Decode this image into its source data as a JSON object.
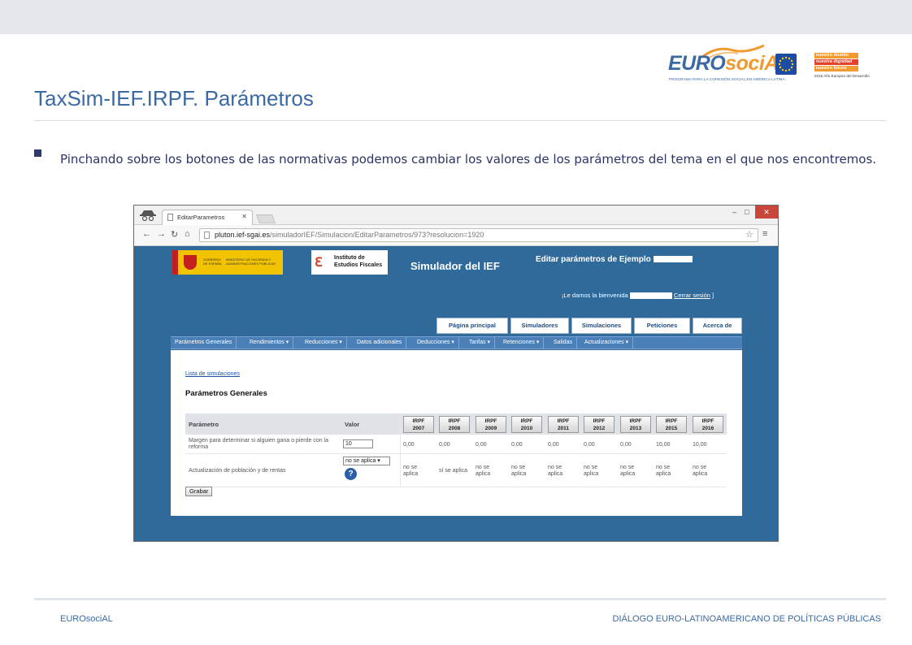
{
  "slide": {
    "title": "TaxSim-IEF.IRPF. Parámetros",
    "bullet": "Pinchando sobre los botones de las normativas podemos cambiar los valores de los parámetros del tema en el que nos encontremos."
  },
  "logos": {
    "eurosocial": {
      "euro": "EURO",
      "social": "sociAL",
      "tagline": "PROGRAMA PARA LA COHESIÓN SOCIAL EN AMÉRICA LATINA"
    },
    "nuestro_mundo": {
      "line1": "nuestro mundo",
      "line2": "nuestra dignidad",
      "line3": "nuestro futuro",
      "year": "2015 Año Europeo del Desarrollo"
    }
  },
  "browser": {
    "tab_title": "EditarParametros",
    "url_host": "pluton.ief-sgai.es",
    "url_path": "/simuladorIEF/Simulacion/EditarParametros/973?resolucion=1920",
    "window_close": "✕"
  },
  "webpage": {
    "gob_text1": "GOBIERNO DE ESPAÑA",
    "gob_text2": "MINISTERIO DE HACIENDA Y ADMINISTRACIONES PÚBLICAS",
    "ief_line1": "Instituto de",
    "ief_line2": "Estudios Fiscales",
    "app_title": "Simulador del IEF",
    "edit_title": "Editar parámetros de Ejemplo",
    "welcome_prefix": "¡Le damos la bienvenida",
    "logout": "Cerrar sesión",
    "welcome_suffix": "]",
    "main_tabs": [
      "Página principal",
      "Simuladores",
      "Simulaciones",
      "Peticiones",
      "Acerca de"
    ],
    "sub_nav": [
      "Parámetros Generales",
      "Rendimientos ▾",
      "Reducciones ▾",
      "Datos adicionales",
      "Deducciones ▾",
      "Tarifas ▾",
      "Retenciones ▾",
      "Salidas",
      "Actualizaciones ▾"
    ],
    "list_link": "Lista de simulaciones",
    "heading": "Parámetros Generales",
    "table": {
      "col_param": "Parámetro",
      "col_value": "Valor",
      "years": [
        {
          "l1": "IRPF",
          "l2": "2007"
        },
        {
          "l1": "IRPF",
          "l2": "2008"
        },
        {
          "l1": "IRPF",
          "l2": "2009"
        },
        {
          "l1": "IRPF",
          "l2": "2010"
        },
        {
          "l1": "IRPF",
          "l2": "2011"
        },
        {
          "l1": "IRPF",
          "l2": "2012"
        },
        {
          "l1": "IRPF",
          "l2": "2013"
        },
        {
          "l1": "IRPF",
          "l2": "2015"
        },
        {
          "l1": "IRPF",
          "l2": "2016"
        }
      ],
      "rows": [
        {
          "param": "Margen para determinar si alguien gana o pierde con la reforma",
          "input_value": "10",
          "values": [
            "0,00",
            "0,00",
            "0,00",
            "0,00",
            "0,00",
            "0,00",
            "0,00",
            "10,00",
            "10,00"
          ]
        },
        {
          "param": "Actualización de población y de rentas",
          "select_value": "no se aplica ▾",
          "help": "?",
          "values": [
            "no se aplica",
            "sí se aplica",
            "no se aplica",
            "no se aplica",
            "no se aplica",
            "no se aplica",
            "no se aplica",
            "no se aplica",
            "no se aplica"
          ]
        }
      ]
    },
    "save_button": "Grabar"
  },
  "footer": {
    "left": "EUROsociAL",
    "right": "DIÁLOGO EURO-LATINOAMERICANO DE POLÍTICAS PÚBLICAS"
  },
  "colors": {
    "title_blue": "#3b69a3",
    "page_blue": "#2f6a9a",
    "nav_blue": "#4a7fb8",
    "accent_orange": "#f19a2f"
  }
}
